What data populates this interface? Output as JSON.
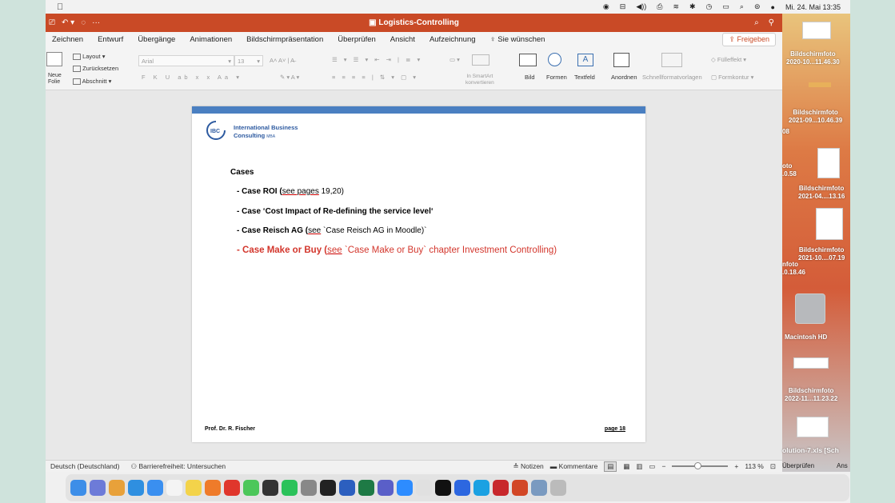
{
  "menubar": {
    "datetime": "Mi. 24. Mai 13:35"
  },
  "titlebar": {
    "title": "Logistics-Controlling"
  },
  "tabs": [
    "Zeichnen",
    "Entwurf",
    "Übergänge",
    "Animationen",
    "Bildschirmpräsentation",
    "Überprüfen",
    "Ansicht",
    "Aufzeichnung",
    "Sie wünschen"
  ],
  "share_label": "Freigeben",
  "ribbon": {
    "new_slide": "Neue\nFolie",
    "layout": "Layout",
    "reset": "Zurücksetzen",
    "section": "Abschnitt",
    "font_name": "Arial",
    "font_size": "13",
    "smartart": "In SmartArt\nkonvertieren",
    "picture": "Bild",
    "shapes": "Formen",
    "textbox": "Textfeld",
    "arrange": "Anordnen",
    "quickstyles": "Schnellformatvorlagen",
    "fill": "Fülleffekt",
    "outline": "Formkontur"
  },
  "slide": {
    "logo_abbr": "IBC",
    "company_line1": "International Business",
    "company_line2": "Consulting",
    "company_suffix": "MBA",
    "heading": "Cases",
    "cases": [
      {
        "bold": "- Case ROI (",
        "under": "see pages",
        "rest": " 19,20)"
      },
      {
        "bold": "- Case ‘Cost Impact of Re-defining the service level‘",
        "under": "",
        "rest": ""
      },
      {
        "bold": "- Case Reisch AG (",
        "under": "see",
        "rest": " `Case Reisch AG in Moodle)`"
      },
      {
        "bold": "- Case Make or Buy (",
        "under": "see",
        "rest": " `Case Make or Buy` chapter Investment Controlling)"
      }
    ],
    "footer_left": "Prof. Dr. R. Fischer",
    "footer_right": "page 18"
  },
  "statusbar": {
    "language": "Deutsch (Deutschland)",
    "accessibility": "Barrierefreiheit: Untersuchen",
    "notes": "Notizen",
    "comments": "Kommentare",
    "zoom": "113 %",
    "zoom_fraction": 0.4
  },
  "desktop": {
    "files": [
      "Bildschirmfoto\n2020-10...11.46.30",
      "Bildschirmfoto\n2021-09...10.46.39",
      "Bildschirmfoto\n2021-04....13.16",
      "Bildschirmfoto\n2021-10....07.19",
      "Macintosh HD",
      "Bildschirmfoto\n2022-11...11.23.22"
    ],
    "fragments": {
      "f08": "08",
      "f58_a": "oto",
      "f58_b": ".0.58",
      "f18_a": "nfoto",
      "f18_b": ".0.18.46"
    },
    "partial_window": "olution-7.xls [Sch",
    "partial_tab": "Überprüfen",
    "partial_tab2": "Ans"
  },
  "colors": {
    "title_bar": "#c94a26",
    "slide_accent": "#4a7fc1",
    "highlight_case": "#d3362c"
  },
  "dock_icons": [
    "finder",
    "launchpad",
    "chrome",
    "safari",
    "mail",
    "calendar",
    "notes",
    "firefox",
    "opera",
    "messages",
    "obs",
    "spotify",
    "settings",
    "sonos",
    "word",
    "excel",
    "teams",
    "zoom",
    "slack",
    "terminal",
    "dropbox",
    "skype",
    "acrobat",
    "powerpoint",
    "preview",
    "trash"
  ]
}
